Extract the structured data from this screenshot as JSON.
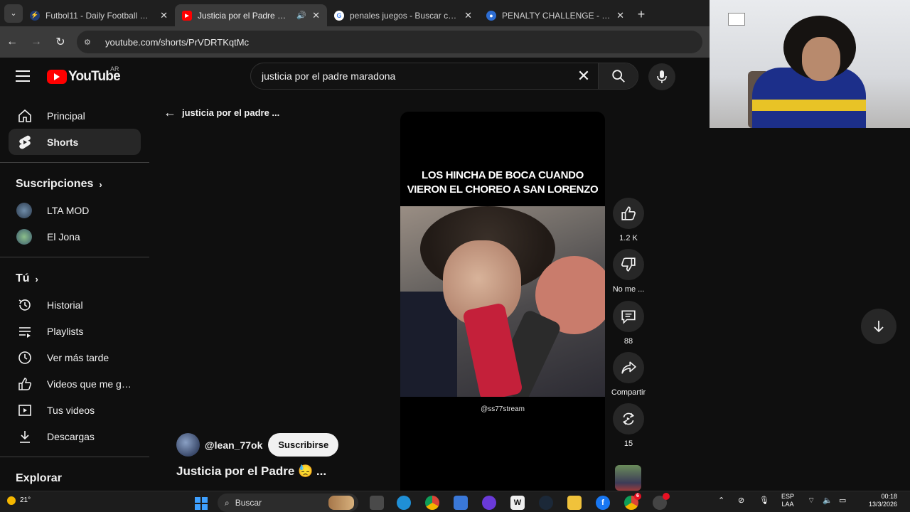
{
  "browser": {
    "tabs": [
      {
        "title": "Futbol11 - Daily Football Games",
        "active": false
      },
      {
        "title": "Justicia por el Padre 😓 #sa",
        "active": true
      },
      {
        "title": "penales juegos - Buscar con Google",
        "active": false
      },
      {
        "title": "PENALTY CHALLENGE - ¡Juega",
        "active": false
      }
    ],
    "url": "youtube.com/shorts/PrVDRTKqtMc"
  },
  "header": {
    "logo_text": "YouTube",
    "country_code": "AR",
    "search_query": "justicia por el padre maradona"
  },
  "sidebar": {
    "top_items": [
      {
        "label": "Principal",
        "icon": "home-icon"
      },
      {
        "label": "Shorts",
        "icon": "shorts-icon",
        "active": true
      }
    ],
    "subscriptions_heading": "Suscripciones",
    "subscriptions": [
      {
        "label": "LTA MOD"
      },
      {
        "label": "El Jona"
      }
    ],
    "you_heading": "Tú",
    "you_items": [
      {
        "label": "Historial",
        "icon": "history-icon"
      },
      {
        "label": "Playlists",
        "icon": "playlists-icon"
      },
      {
        "label": "Ver más tarde",
        "icon": "watch-later-icon"
      },
      {
        "label": "Videos que me gus...",
        "icon": "liked-videos-icon"
      },
      {
        "label": "Tus videos",
        "icon": "your-videos-icon"
      },
      {
        "label": "Descargas",
        "icon": "downloads-icon"
      }
    ],
    "explore_heading": "Explorar"
  },
  "back_link": "justicia por el padre ...",
  "short": {
    "caption_line1": "LOS HINCHA DE BOCA CUANDO",
    "caption_line2": "VIERON EL CHOREO A SAN LORENZO",
    "watermark": "@ss77stream",
    "channel": "@lean_77ok",
    "subscribe_label": "Suscribirse",
    "title": "Justicia por el Padre 😓 ..."
  },
  "actions": {
    "likes": "1.2 K",
    "dislike_label": "No me ...",
    "comments": "88",
    "share_label": "Compartir",
    "remix_count": "15"
  },
  "taskbar": {
    "temperature": "21°",
    "search_placeholder": "Buscar",
    "lang_line1": "ESP",
    "lang_line2": "LAA",
    "time": "00:18",
    "date": "13/3/2026",
    "chrome_badge": "6"
  }
}
